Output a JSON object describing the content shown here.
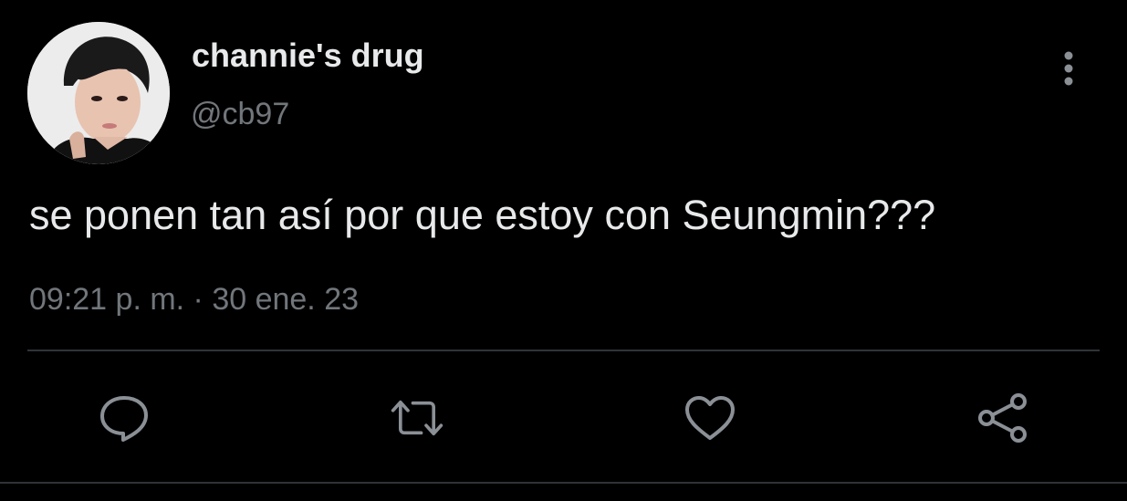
{
  "author": {
    "display_name": "channie's drug",
    "handle": "@cb97"
  },
  "tweet": {
    "text": "se ponen tan así por que estoy con Seungmin???",
    "timestamp": "09:21 p. m. · 30 ene. 23"
  },
  "icons": {
    "more": "more-vertical-icon",
    "reply": "reply-icon",
    "retweet": "retweet-icon",
    "like": "heart-icon",
    "share": "share-icon"
  },
  "colors": {
    "background": "#000000",
    "primary_text": "#e7e9ea",
    "secondary_text": "#71767b",
    "icon": "#71767b",
    "divider": "#2f3336"
  }
}
